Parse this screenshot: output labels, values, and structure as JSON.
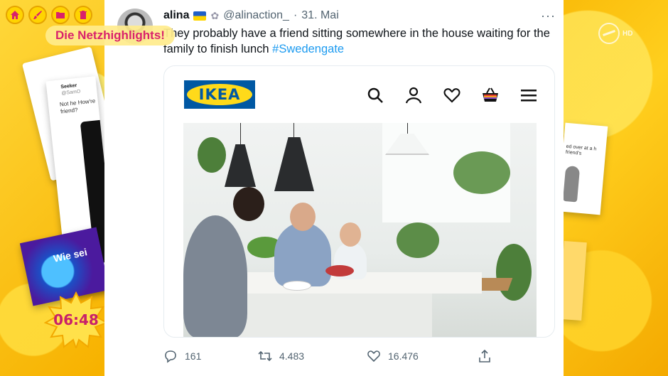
{
  "overlay": {
    "highlight_label": "Die Netzhighlights!",
    "clock_time": "06:48",
    "left_card_user": "Seeker",
    "left_card_handle": "@SamO",
    "left_card_text": "Not he How're friend?",
    "left_card_badge": "Wie sei",
    "right_card_text": "ed over at a h friend's",
    "toolbar": [
      "home-icon",
      "brush-icon",
      "folder-icon",
      "trash-icon"
    ]
  },
  "tweet": {
    "name": "alina",
    "flag": "🇺🇦",
    "handle": "@alinaction_",
    "separator": "·",
    "date": "31. Mai",
    "more": "···",
    "text": "They probably have a friend sitting somewhere in the house waiting for the family to finish lunch",
    "hashtag": "#Swedengate",
    "media": {
      "brand_logo": "IKEA",
      "icons": [
        "search-icon",
        "account-icon",
        "heart-icon",
        "basket-icon",
        "menu-icon"
      ]
    },
    "stats": {
      "replies": "161",
      "retweets": "4.483",
      "likes": "16.476"
    }
  },
  "colors": {
    "accent_pink": "#d9226b",
    "twitter_blue": "#1d9bf0",
    "ikea_blue": "#0058a3",
    "ikea_yellow": "#ffda1a"
  }
}
